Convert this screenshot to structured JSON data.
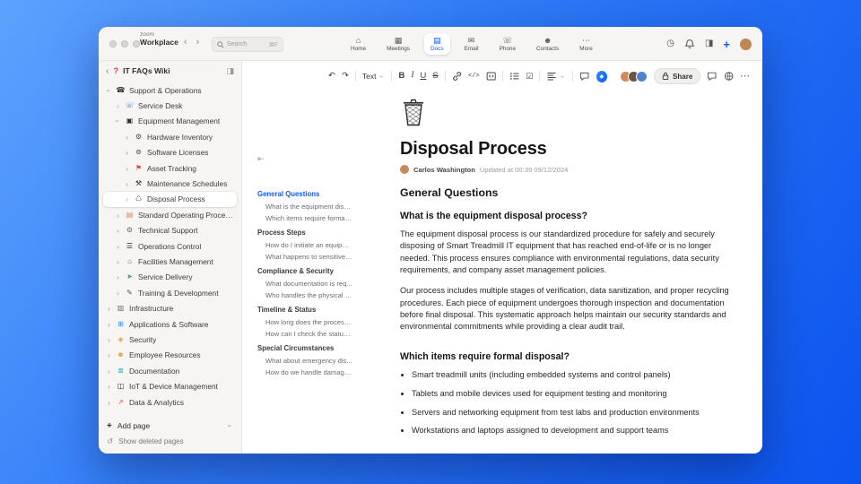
{
  "titlebar": {
    "brand_top": "zoom",
    "brand_bottom": "Workplace",
    "search": {
      "placeholder": "Search",
      "shortcut": "⌘F"
    },
    "tabs": [
      {
        "label": "Home",
        "icon": "home-icon",
        "glyph": "⌂",
        "active": false
      },
      {
        "label": "Meetings",
        "icon": "meetings-icon",
        "glyph": "▦",
        "active": false
      },
      {
        "label": "Docs",
        "icon": "docs-icon",
        "glyph": "▤",
        "active": true
      },
      {
        "label": "Email",
        "icon": "email-icon",
        "glyph": "✉",
        "active": false
      },
      {
        "label": "Phone",
        "icon": "phone-icon",
        "glyph": "☏",
        "active": false
      },
      {
        "label": "Contacts",
        "icon": "contacts-icon",
        "glyph": "☻",
        "active": false
      },
      {
        "label": "More",
        "icon": "more-icon",
        "glyph": "⋯",
        "active": false
      }
    ]
  },
  "sidebar": {
    "wiki_icon": "?",
    "title": "IT FAQs Wiki",
    "tree": [
      {
        "label": "Support & Operations",
        "depth": 0,
        "icon": "phone-icon",
        "glyph": "☎",
        "color": "#2b2b2b",
        "chevron": "down"
      },
      {
        "label": "Service Desk",
        "depth": 1,
        "icon": "headset-icon",
        "glyph": "☏",
        "color": "#2d8cff",
        "chevron": "right"
      },
      {
        "label": "Equipment Management",
        "depth": 1,
        "icon": "laptop-icon",
        "glyph": "▣",
        "color": "#2b2b2b",
        "chevron": "down"
      },
      {
        "label": "Hardware Inventory",
        "depth": 2,
        "icon": "hardware-icon",
        "glyph": "⚙",
        "color": "#4a4a4a",
        "chevron": "right"
      },
      {
        "label": "Software Licenses",
        "depth": 2,
        "icon": "disc-icon",
        "glyph": "⊚",
        "color": "#4a4a4a",
        "chevron": "right"
      },
      {
        "label": "Asset Tracking",
        "depth": 2,
        "icon": "pin-icon",
        "glyph": "⚑",
        "color": "#e0443e",
        "chevron": "right"
      },
      {
        "label": "Maintenance Schedules",
        "depth": 2,
        "icon": "tools-icon",
        "glyph": "⚒",
        "color": "#2b2b2b",
        "chevron": "right"
      },
      {
        "label": "Disposal Process",
        "depth": 2,
        "icon": "trash-icon",
        "glyph": "♺",
        "color": "#6a6a6a",
        "chevron": "right",
        "selected": true
      },
      {
        "label": "Standard Operating Procedures",
        "depth": 1,
        "icon": "book-icon",
        "glyph": "▤",
        "color": "#e8883a",
        "chevron": "right"
      },
      {
        "label": "Technical Support",
        "depth": 1,
        "icon": "gear-icon",
        "glyph": "⚙",
        "color": "#6a6a6a",
        "chevron": "right"
      },
      {
        "label": "Operations Control",
        "depth": 1,
        "icon": "sliders-icon",
        "glyph": "☰",
        "color": "#2b2b2b",
        "chevron": "right"
      },
      {
        "label": "Facilities Management",
        "depth": 1,
        "icon": "building-icon",
        "glyph": "⌂",
        "color": "#555555",
        "chevron": "right"
      },
      {
        "label": "Service Delivery",
        "depth": 1,
        "icon": "truck-icon",
        "glyph": "➤",
        "color": "#3aa757",
        "chevron": "right"
      },
      {
        "label": "Training & Development",
        "depth": 1,
        "icon": "training-icon",
        "glyph": "✎",
        "color": "#555555",
        "chevron": "right"
      },
      {
        "label": "Infrastructure",
        "depth": 0,
        "icon": "server-icon",
        "glyph": "▥",
        "color": "#6a6a6a",
        "chevron": "right"
      },
      {
        "label": "Applications & Software",
        "depth": 0,
        "icon": "apps-icon",
        "glyph": "⊞",
        "color": "#2d8cff",
        "chevron": "right"
      },
      {
        "label": "Security",
        "depth": 0,
        "icon": "shield-icon",
        "glyph": "◈",
        "color": "#e0a13e",
        "chevron": "right"
      },
      {
        "label": "Employee Resources",
        "depth": 0,
        "icon": "people-icon",
        "glyph": "☻",
        "color": "#e8a33d",
        "chevron": "right"
      },
      {
        "label": "Documentation",
        "depth": 0,
        "icon": "library-icon",
        "glyph": "≣",
        "color": "#2aa1c0",
        "chevron": "right"
      },
      {
        "label": "IoT & Device Management",
        "depth": 0,
        "icon": "device-icon",
        "glyph": "◫",
        "color": "#2b2b2b",
        "chevron": "right"
      },
      {
        "label": "Data & Analytics",
        "depth": 0,
        "icon": "chart-icon",
        "glyph": "↗",
        "color": "#d9534f",
        "chevron": "right"
      }
    ],
    "add_page": "Add page",
    "show_deleted": "Show deleted pages"
  },
  "toolbar": {
    "text_style": "Text",
    "share_label": "Share",
    "avatars": [
      "#d08a5e",
      "#6e5340",
      "#4f86c9"
    ]
  },
  "toc": {
    "items": [
      {
        "label": "General Questions",
        "kind": "section",
        "active": true
      },
      {
        "label": "What is the equipment disp...",
        "kind": "item"
      },
      {
        "label": "Which items require formal ...",
        "kind": "item"
      },
      {
        "label": "Process Steps",
        "kind": "section"
      },
      {
        "label": "How do I initiate an equipm...",
        "kind": "item"
      },
      {
        "label": "What happens to sensitive ...",
        "kind": "item"
      },
      {
        "label": "Compliance & Security",
        "kind": "section"
      },
      {
        "label": "What documentation is req...",
        "kind": "item"
      },
      {
        "label": "Who handles the physical di...",
        "kind": "item"
      },
      {
        "label": "Timeline & Status",
        "kind": "section"
      },
      {
        "label": "How long does the process ...",
        "kind": "item"
      },
      {
        "label": "How can I check the status ...",
        "kind": "item"
      },
      {
        "label": "Special Circumstances",
        "kind": "section"
      },
      {
        "label": "What about emergency dis...",
        "kind": "item"
      },
      {
        "label": "How do we handle damage...",
        "kind": "item"
      }
    ]
  },
  "doc": {
    "title": "Disposal Process",
    "author": "Carlos Washington",
    "updated": "Updated at 00:39 09/12/2024",
    "section_heading": "General Questions",
    "q1": "What is the equipment disposal process?",
    "p1": "The equipment disposal process is our standardized procedure for safely and securely disposing of Smart Treadmill IT equipment that has reached end-of-life or is no longer needed. This process ensures compliance with environmental regulations, data security requirements, and company asset management policies.",
    "p2": "Our process includes multiple stages of verification, data sanitization, and proper recycling procedures. Each piece of equipment undergoes thorough inspection and documentation before final disposal. This systematic approach helps maintain our security standards and environmental commitments while providing a clear audit trail.",
    "q2": "Which items require formal disposal?",
    "bullets": [
      "Smart treadmill units (including embedded systems and control panels)",
      "Tablets and mobile devices used for equipment testing and monitoring",
      "Servers and networking equipment from test labs and production environments",
      "Workstations and laptops assigned to development and support teams"
    ]
  }
}
